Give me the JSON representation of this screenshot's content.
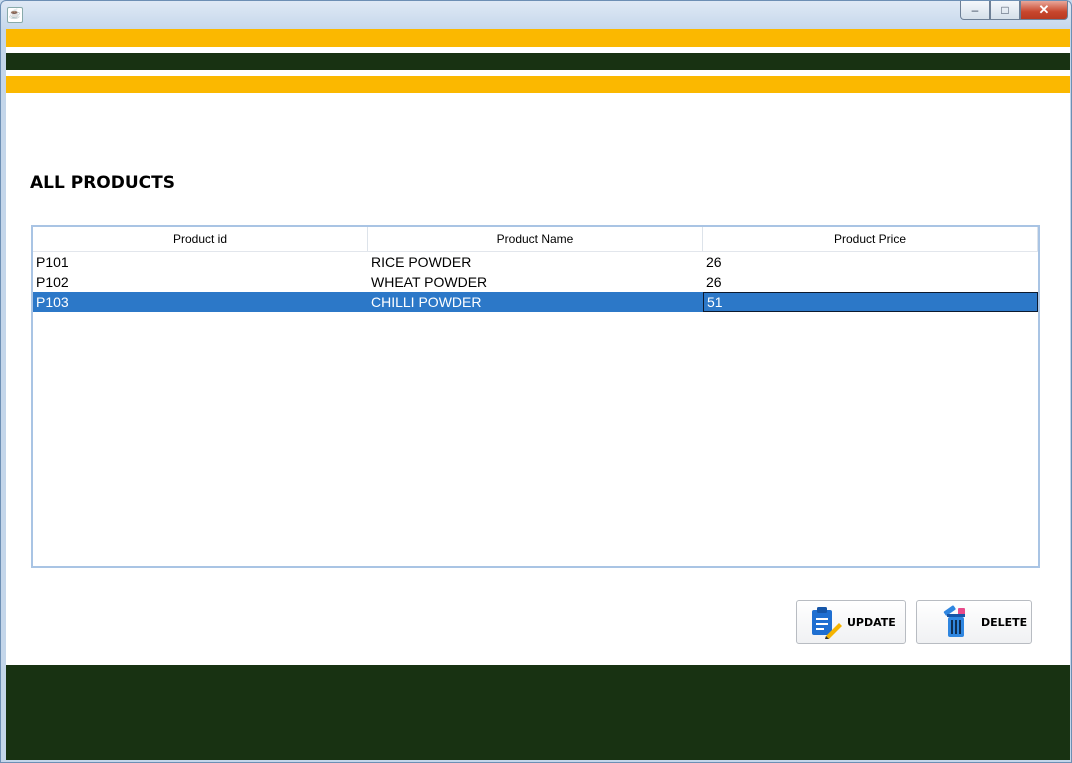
{
  "window": {
    "title": "",
    "controls": {
      "minimize": "–",
      "maximize": "□",
      "close": "✕"
    }
  },
  "page": {
    "heading": "ALL PRODUCTS"
  },
  "table": {
    "columns": [
      "Product id",
      "Product Name",
      "Product Price"
    ],
    "rows": [
      {
        "id": "P101",
        "name": "RICE POWDER",
        "price": "26"
      },
      {
        "id": "P102",
        "name": "WHEAT POWDER",
        "price": "26"
      },
      {
        "id": "P103",
        "name": "CHILLI POWDER",
        "price": "51",
        "selected": true
      }
    ]
  },
  "actions": {
    "update_label": "UPDATE",
    "delete_label": "DELETE"
  },
  "colors": {
    "accent_yellow": "#fbb800",
    "dark_green": "#183212",
    "selection_blue": "#2c78c8"
  },
  "icons": {
    "app": "java-app-icon",
    "update": "clipboard-edit-icon",
    "delete": "trash-bin-icon"
  }
}
